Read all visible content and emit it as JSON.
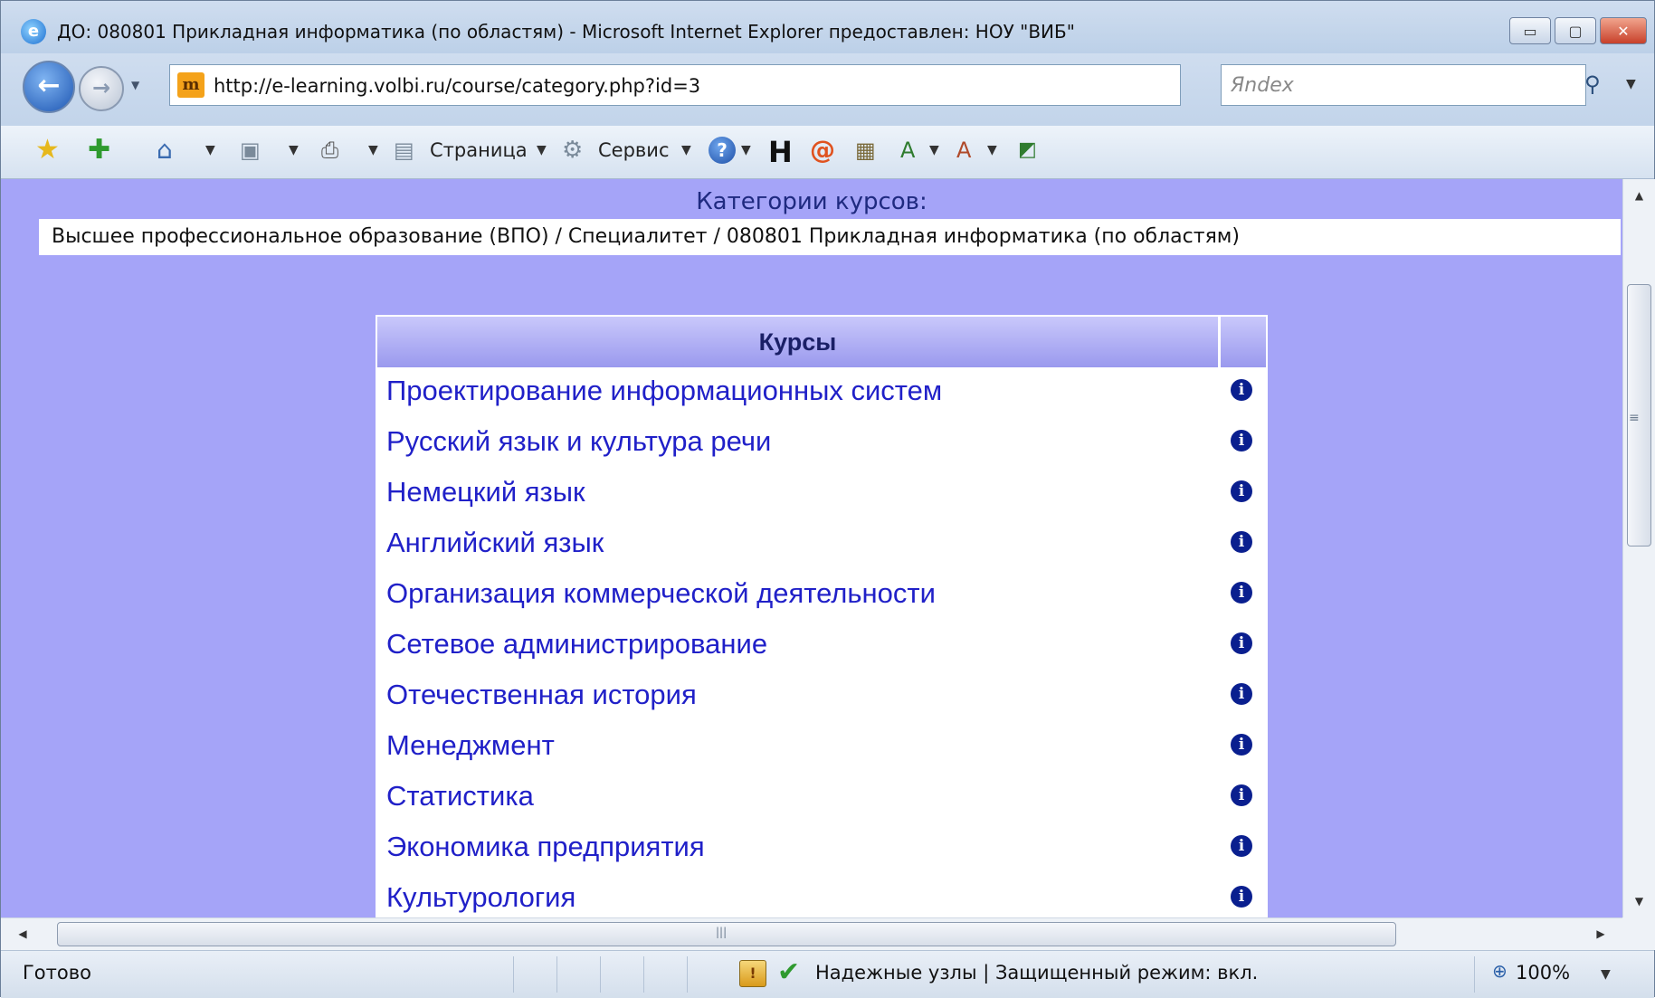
{
  "window": {
    "title": "ДО: 080801 Прикладная информатика (по областям) - Microsoft Internet Explorer предоставлен: НОУ \"ВИБ\"",
    "min_glyph": "▭",
    "max_glyph": "▢",
    "close_glyph": "✕"
  },
  "nav": {
    "back_glyph": "←",
    "forward_glyph": "→",
    "url": "http://e-learning.volbi.ru/course/category.php?id=3",
    "search_placeholder": "Яndex"
  },
  "toolbar": {
    "page_label": "Страница",
    "tools_label": "Сервис"
  },
  "content": {
    "category_heading": "Категории курсов:",
    "breadcrumb": "Высшее профессиональное образование (ВПО) / Специалитет / 080801 Прикладная информатика (по областям)",
    "courses_header": "Курсы",
    "courses": [
      "Проектирование информационных систем",
      "Русский язык и культура речи",
      "Немецкий язык",
      "Английский язык",
      "Организация коммерческой деятельности",
      "Сетевое администрирование",
      "Отечественная история",
      "Менеджмент",
      "Статистика",
      "Экономика предприятия",
      "Культурология"
    ],
    "info_glyph": "i"
  },
  "status": {
    "text": "Готово",
    "zone": "Надежные узлы | Защищенный режим: вкл.",
    "zoom": "100%"
  },
  "colors": {
    "page_background": "#a5a4f8",
    "link": "#2020c8",
    "header_text": "#1a1f66"
  }
}
